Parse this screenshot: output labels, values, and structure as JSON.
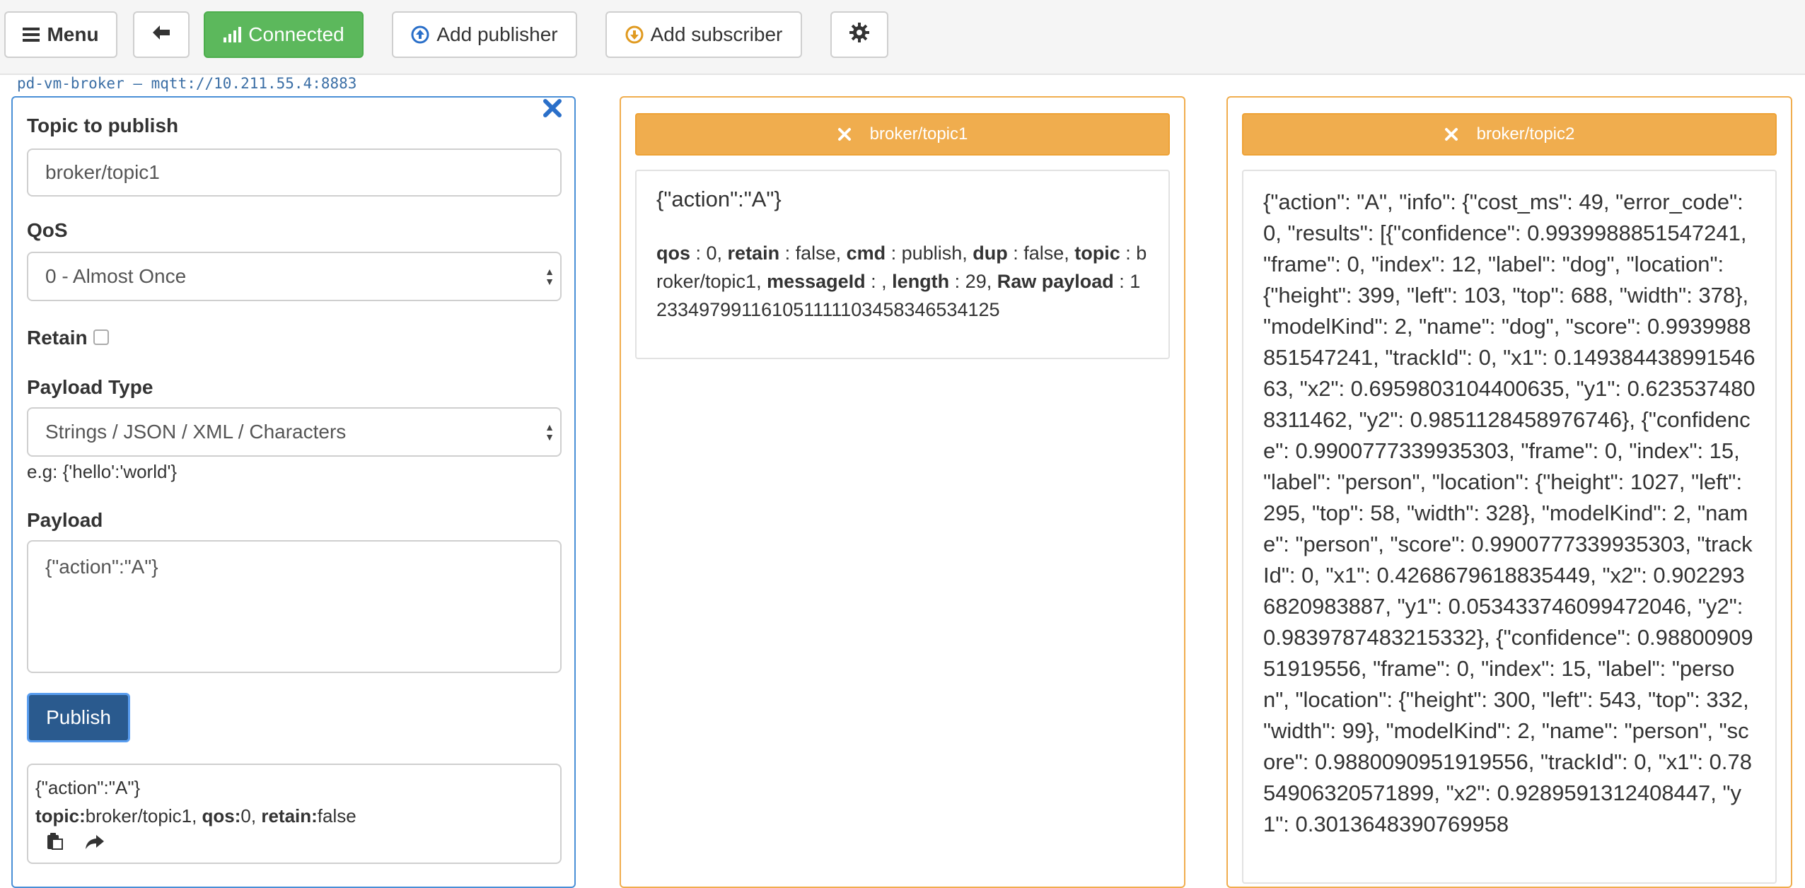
{
  "toolbar": {
    "menu_label": "Menu",
    "connected_label": "Connected",
    "add_publisher_label": "Add publisher",
    "add_subscriber_label": "Add subscriber",
    "colors": {
      "success": "#5cb85c",
      "warning": "#f0ad4e",
      "primary": "#2a5a8e"
    }
  },
  "connection": {
    "info": "pd-vm-broker — mqtt://10.211.55.4:8883"
  },
  "publisher": {
    "topic_label": "Topic to publish",
    "topic_value": "broker/topic1",
    "qos_label": "QoS",
    "qos_value": "0 - Almost Once",
    "retain_label": "Retain",
    "retain_checked": false,
    "payload_type_label": "Payload Type",
    "payload_type_value": "Strings / JSON / XML / Characters",
    "payload_type_hint": "e.g: {'hello':'world'}",
    "payload_label": "Payload",
    "payload_value": "{\"action\":\"A\"}",
    "publish_label": "Publish",
    "log": {
      "message": "{\"action\":\"A\"}",
      "topic_key": "topic:",
      "topic_val": "broker/topic1, ",
      "qos_key": "qos:",
      "qos_val": "0, ",
      "retain_key": "retain:",
      "retain_val": "false"
    }
  },
  "subscribers": [
    {
      "topic": "broker/topic1",
      "message": "{\"action\":\"A\"}",
      "meta": {
        "qos_key": "qos",
        "qos_val": " : 0, ",
        "retain_key": "retain",
        "retain_val": " : false, ",
        "cmd_key": "cmd",
        "cmd_val": " : publish, ",
        "dup_key": "dup",
        "dup_val": " : false, ",
        "topic_key": "topic",
        "topic_val": " : broker/topic1, ",
        "msgid_key": "messageId",
        "msgid_val": " : , ",
        "length_key": "length",
        "length_val": " : 29, ",
        "raw_key": "Raw payload",
        "raw_val": " : 1233497991161051111103458346534125"
      }
    },
    {
      "topic": "broker/topic2",
      "message": "{\"action\": \"A\", \"info\": {\"cost_ms\": 49, \"error_code\": 0, \"results\": [{\"confidence\": 0.9939988851547241, \"frame\": 0, \"index\": 12, \"label\": \"dog\", \"location\": {\"height\": 399, \"left\": 103, \"top\": 688, \"width\": 378}, \"modelKind\": 2, \"name\": \"dog\", \"score\": 0.9939988851547241, \"trackId\": 0, \"x1\": 0.14938443899154663, \"x2\": 0.6959803104400635, \"y1\": 0.6235374808311462, \"y2\": 0.9851128458976746}, {\"confidence\": 0.9900777339935303, \"frame\": 0, \"index\": 15, \"label\": \"person\", \"location\": {\"height\": 1027, \"left\": 295, \"top\": 58, \"width\": 328}, \"modelKind\": 2, \"name\": \"person\", \"score\": 0.9900777339935303, \"trackId\": 0, \"x1\": 0.4268679618835449, \"x2\": 0.9022936820983887, \"y1\": 0.053433746099472046, \"y2\": 0.9839787483215332}, {\"confidence\": 0.9880090951919556, \"frame\": 0, \"index\": 15, \"label\": \"person\", \"location\": {\"height\": 300, \"left\": 543, \"top\": 332, \"width\": 99}, \"modelKind\": 2, \"name\": \"person\", \"score\": 0.9880090951919556, \"trackId\": 0, \"x1\": 0.7854906320571899, \"x2\": 0.9289591312408447, \"y1\": 0.3013648390769958"
    }
  ]
}
